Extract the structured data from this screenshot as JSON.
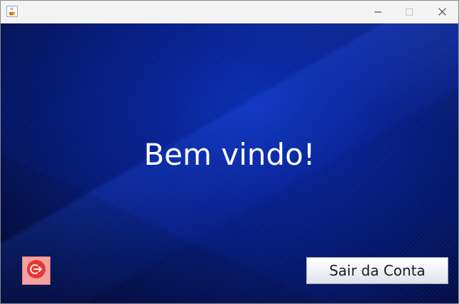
{
  "window": {
    "title": "",
    "icons": {
      "app": "java-cup-icon",
      "minimize": "minimize-icon",
      "maximize": "maximize-icon",
      "close": "close-icon"
    }
  },
  "main": {
    "welcome_text": "Bem vindo!",
    "logout_icon": "logout-icon",
    "signout_label": "Sair da Conta"
  },
  "colors": {
    "background_primary": "#06208f",
    "background_dark": "#020a3a",
    "logout_icon_bg": "#f3a1a1",
    "logout_icon_circle": "#e53935"
  }
}
